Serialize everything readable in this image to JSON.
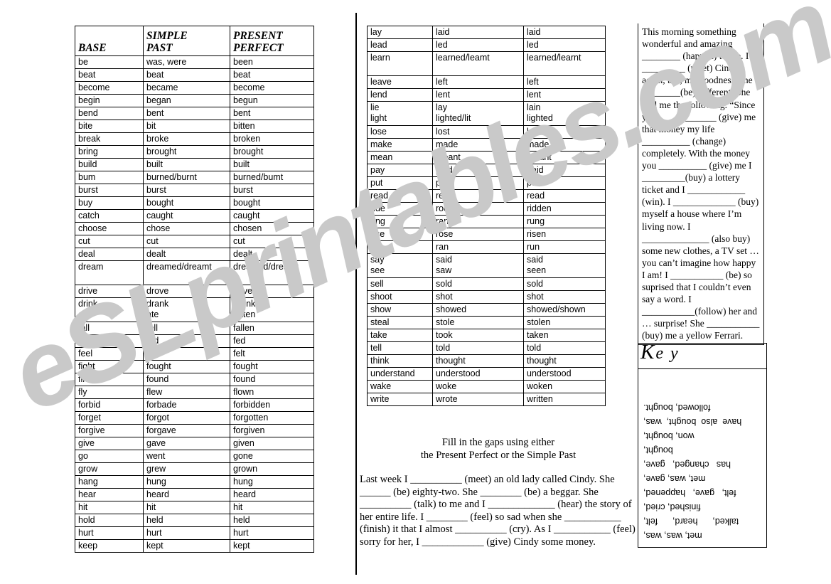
{
  "watermark": {
    "text": "eSLprintables.com"
  },
  "tables": {
    "left": {
      "headers": [
        "BASE",
        "SIMPLE PAST",
        "PRESENT PERFECT"
      ],
      "header_lines": [
        [
          "BASE"
        ],
        [
          "SIMPLE",
          "PAST"
        ],
        [
          "PRESENT",
          "PERFECT"
        ]
      ],
      "rows": [
        [
          "be",
          "was, were",
          "been"
        ],
        [
          "beat",
          "beat",
          "beat"
        ],
        [
          "become",
          "became",
          "become"
        ],
        [
          "begin",
          "began",
          "begun"
        ],
        [
          "bend",
          "bent",
          "bent"
        ],
        [
          "bite",
          "bit",
          "bitten"
        ],
        [
          "break",
          "broke",
          "broken"
        ],
        [
          "bring",
          "brought",
          "brought"
        ],
        [
          "build",
          "built",
          "built"
        ],
        [
          "bum",
          "burned/burnt",
          "burned/bumt"
        ],
        [
          "burst",
          "burst",
          "burst"
        ],
        [
          "buy",
          "bought",
          "bought"
        ],
        [
          "catch",
          "caught",
          "caught"
        ],
        [
          "choose",
          "chose",
          "chosen"
        ],
        [
          "cut",
          "cut",
          "cut"
        ],
        [
          "deal",
          "dealt",
          "dealt"
        ],
        [
          "dream",
          "dreamed/dreamt",
          "dreamed/dreamt"
        ],
        [
          "drive",
          "drove",
          "driven"
        ],
        [
          "drink\neat",
          "drank\nate",
          "drunk\neaten"
        ],
        [
          "fall",
          "fell",
          "fallen"
        ],
        [
          "feed",
          "fed",
          "fed"
        ],
        [
          "feel",
          "felt",
          "felt"
        ],
        [
          "fight",
          "fought",
          "fought"
        ],
        [
          "find",
          "found",
          "found"
        ],
        [
          "fly",
          "flew",
          "flown"
        ],
        [
          "forbid",
          "forbade",
          "forbidden"
        ],
        [
          "forget",
          "forgot",
          "forgotten"
        ],
        [
          "forgive",
          "forgave",
          "forgiven"
        ],
        [
          "give",
          "gave",
          "given"
        ],
        [
          "go",
          "went",
          "gone"
        ],
        [
          "grow",
          "grew",
          "grown"
        ],
        [
          "hang",
          "hung",
          "hung"
        ],
        [
          "hear",
          "heard",
          "heard"
        ],
        [
          "hit",
          "hit",
          "hit"
        ],
        [
          "hold",
          "held",
          "held"
        ],
        [
          "hurt",
          "hurt",
          "hurt"
        ],
        [
          "keep",
          "kept",
          "kept"
        ]
      ]
    },
    "right": {
      "rows": [
        [
          "lay",
          "laid",
          "laid"
        ],
        [
          "lead",
          "led",
          "led"
        ],
        [
          "learn",
          "learned/leamt",
          "learned/learnt"
        ],
        [
          "leave",
          "left",
          "left"
        ],
        [
          "lend",
          "lent",
          "lent"
        ],
        [
          "lie\nlight",
          "lay\nlighted/lit",
          "lain\nlighted"
        ],
        [
          "lose",
          "lost",
          "lost"
        ],
        [
          "make",
          "made",
          "made"
        ],
        [
          "mean",
          "meant",
          "meant"
        ],
        [
          "pay",
          "paid",
          "paid"
        ],
        [
          "put",
          "put",
          "put"
        ],
        [
          "read",
          "read",
          "read"
        ],
        [
          "ride",
          "rode",
          "ridden"
        ],
        [
          "ring",
          "rang",
          "rung"
        ],
        [
          "rise",
          "rose",
          "risen"
        ],
        [
          "run",
          "ran",
          "run"
        ],
        [
          "say\nsee",
          "said\nsaw",
          "said\nseen"
        ],
        [
          "sell",
          "sold",
          "sold"
        ],
        [
          "shoot",
          "shot",
          "shot"
        ],
        [
          "show",
          "showed",
          "showed/shown"
        ],
        [
          "steal",
          "stole",
          "stolen"
        ],
        [
          "take",
          "took",
          "taken"
        ],
        [
          "tell",
          "told",
          "told"
        ],
        [
          "think",
          "thought",
          "thought"
        ],
        [
          "understand",
          "understood",
          "understood"
        ],
        [
          "wake",
          "woke",
          "woken"
        ],
        [
          "write",
          "wrote",
          "written"
        ]
      ]
    }
  },
  "exercise": {
    "title_line1": "Fill in the gaps using either",
    "title_line2": "the Present Perfect or the Simple Past",
    "body": "Last week I __________ (meet) an old lady called Cindy. She ______ (be) eighty-two. She ________ (be) a beggar. She __________ (talk) to me and I _____________ (hear) the story of her entire life. I ________ (feel) so sad when she ___________ (finish) it that I almost __________ (cry). As I ___________ (feel) sorry for her, I ____________ (give)  Cindy some money."
  },
  "passage": {
    "text": "This morning something wonderful and amazing ________ (happen) to me. I _________ (meet) Cindy again, but, my goodness, she ________(be) different. She told me the following. “Since you ____________ (give) me that money my life __________ (change) completely. With the money you __________ (give) me I _________(buy) a lottery ticket and I ____________ (win). I _____________ (buy) myself a house where I’m living now. I ______________ (also buy) some new clothes, a TV set … you can’t imagine how happy I am! I ___________ (be) so suprised that I couldn’t even say a word. I ___________(follow) her and … surprise! She ___________ (buy) me a yellow Ferrari."
  },
  "key": {
    "title_initial": "K",
    "title_rest": "e y",
    "lines": [
      "met, was, was,",
      "talked,      heard,      felt,",
      "finished, cried,",
      "felt,   gave,   happened,",
      "met, was, gave,",
      "has   changed,   gave,",
      "bought,",
      "won, bought,",
      "have  also  bought,  was,",
      "followed, bought."
    ]
  }
}
